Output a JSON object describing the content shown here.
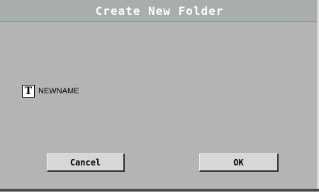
{
  "dialog": {
    "title": "Create New Folder",
    "name_field": {
      "icon_glyph": "T",
      "icon": "text-edit-icon",
      "value": "NEWNAME"
    },
    "buttons": {
      "cancel_label": "Cancel",
      "ok_label": "OK"
    }
  },
  "colors": {
    "background": "#b4b4b4",
    "title_bar": "#a8aeac",
    "title_text": "#ffffff",
    "button_face": "#d7d7d7"
  }
}
